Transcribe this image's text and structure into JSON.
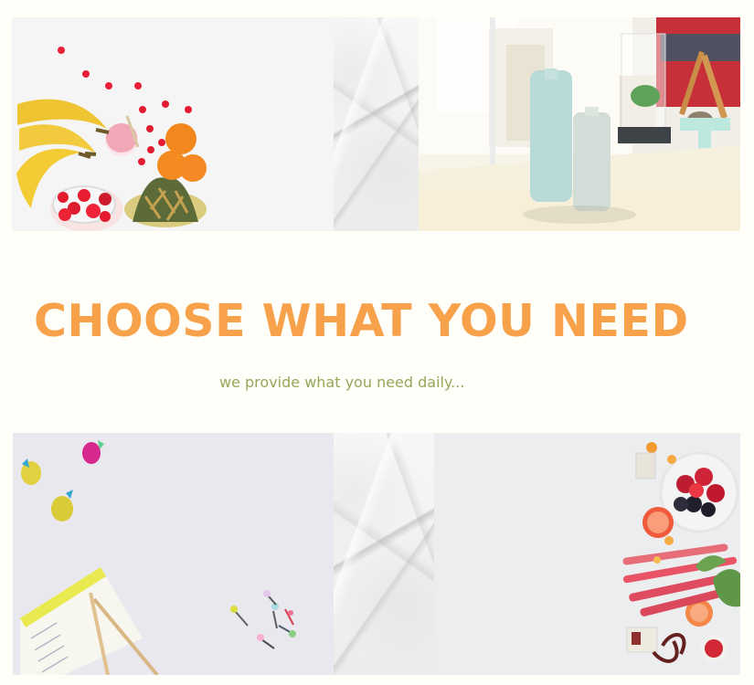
{
  "page": {
    "title": "CHOOSE WHAT YOU NEED",
    "subtitle": "we provide what you need daily..."
  },
  "gallery": [
    {
      "label": "fruit photo with bananas, smoothie, strawberries, oranges and pineapple"
    },
    {
      "label": "photo of two matte bottles on a bright table"
    },
    {
      "label": "photo of desk with eraser toys, pencils, note pad and pushpins"
    },
    {
      "label": "photo of fruits, berries, rhubarb and citrus on light background"
    }
  ],
  "colors": {
    "background": "#fffef9",
    "title": "#f7a24b",
    "subtitle": "#95a85a"
  },
  "icons": {
    "marble": "marble-texture-icon"
  }
}
